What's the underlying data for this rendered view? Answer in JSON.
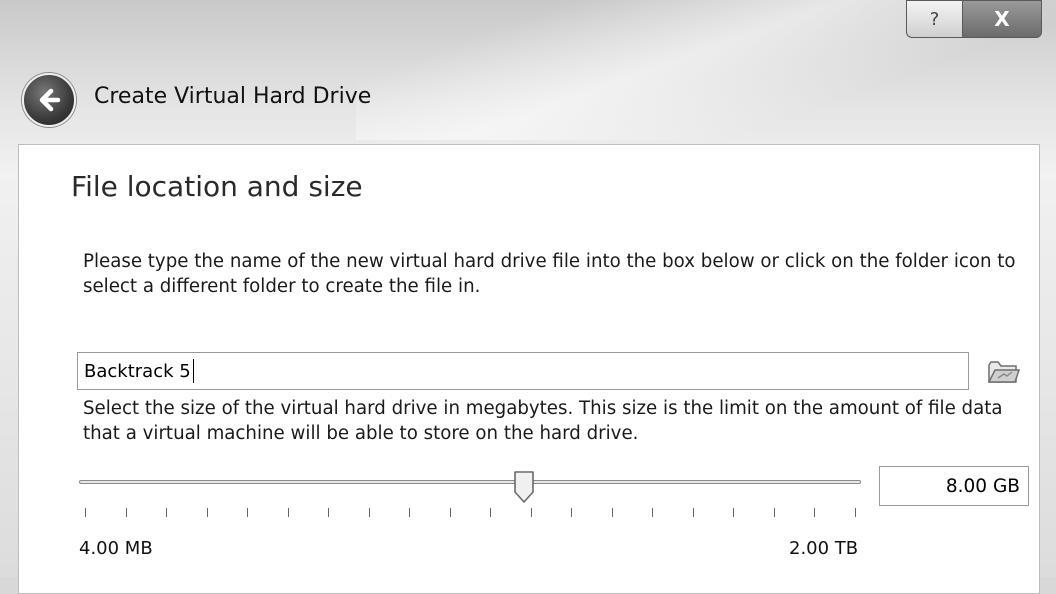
{
  "window": {
    "help_label": "?",
    "close_label": "X"
  },
  "wizard": {
    "title": "Create Virtual Hard Drive"
  },
  "page": {
    "heading": "File location and size",
    "location_description": "Please type the name of the new virtual hard drive file into the box below or click on the folder icon to select a different folder to create the file in.",
    "file_name": "Backtrack 5",
    "size_description": "Select the size of the virtual hard drive in megabytes. This size is the limit on the amount of file data that a virtual machine will be able to store on the hard drive.",
    "size_value": "8.00 GB",
    "slider_position": 0.57,
    "range_min": "4.00 MB",
    "range_max": "2.00 TB"
  },
  "icons": {
    "back": "back-arrow-icon",
    "folder": "folder-icon"
  }
}
